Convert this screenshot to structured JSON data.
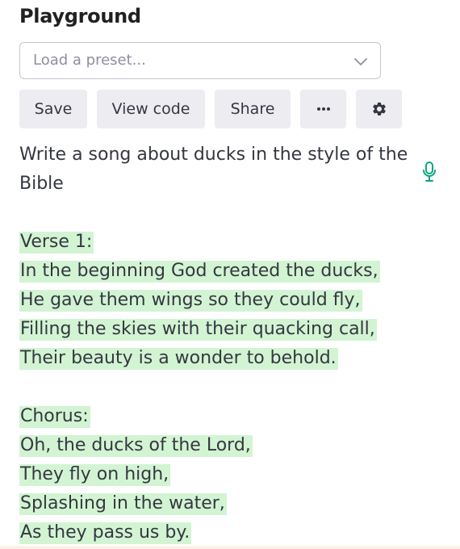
{
  "header": {
    "title": "Playground"
  },
  "preset": {
    "placeholder": "Load a preset...",
    "chevron_icon": "chevron-down-icon"
  },
  "toolbar": {
    "save_label": "Save",
    "view_code_label": "View code",
    "share_label": "Share",
    "more_icon": "ellipsis-icon",
    "settings_icon": "gear-icon"
  },
  "editor": {
    "prompt_lines": [
      "Write a song about ducks in the style of the",
      "Bible"
    ],
    "completion_lines": [
      "Verse 1:",
      "In the beginning God created the ducks,",
      "He gave them wings so they could fly,",
      "Filling the skies with their quacking call,",
      "Their beauty is a wonder to behold.",
      "Chorus:",
      "Oh, the ducks of the Lord,",
      "They fly on high,",
      "Splashing in the water,",
      "As they pass us by."
    ],
    "mic_icon": "microphone-icon"
  },
  "colors": {
    "completion_highlight": "#d2f4d3",
    "mic_accent": "#10a37f",
    "button_bg": "#ececf1"
  }
}
